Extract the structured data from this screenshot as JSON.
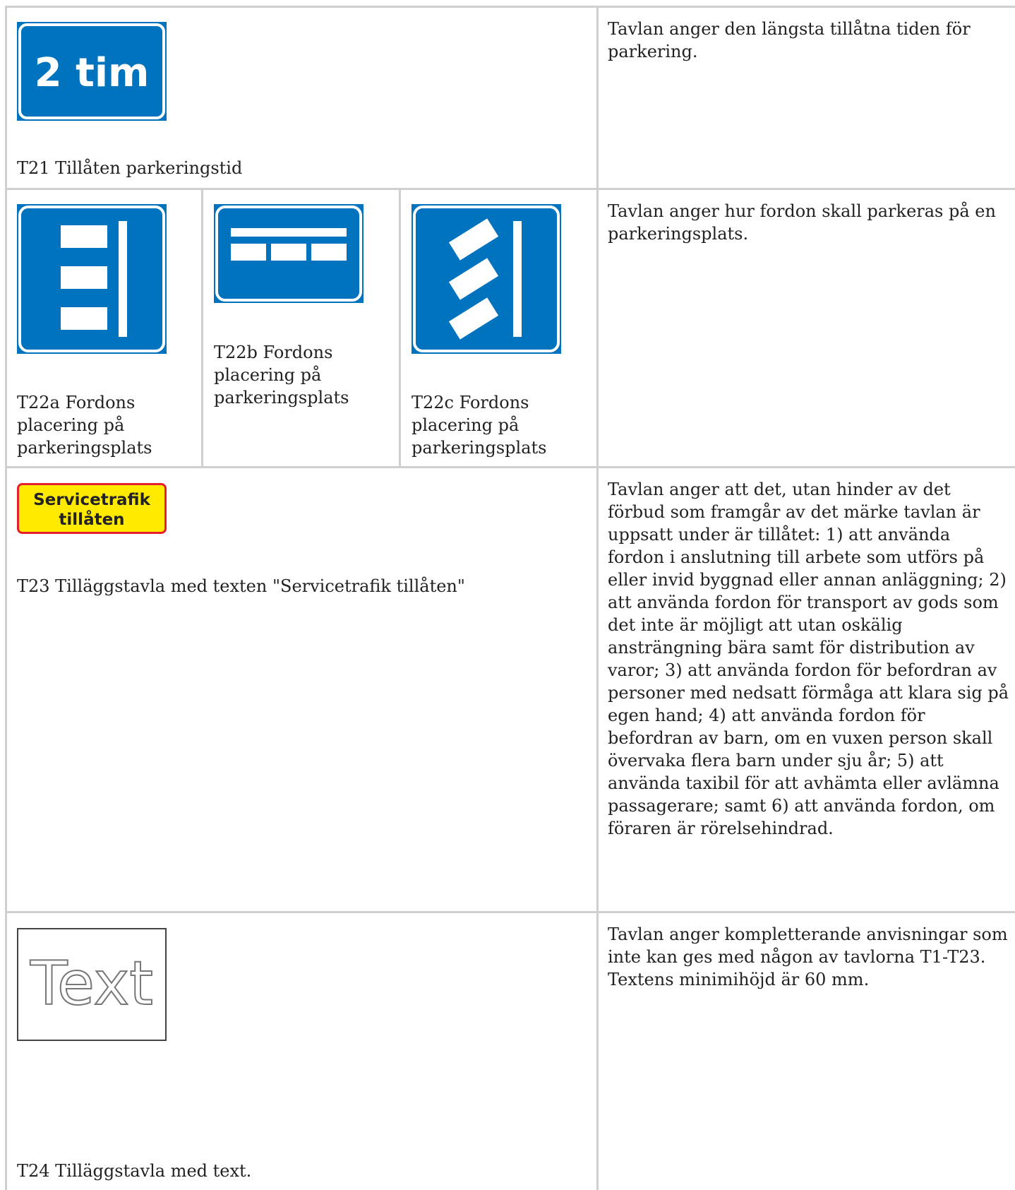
{
  "rows": [
    {
      "signs": [
        {
          "sign_text": "2 tim",
          "caption": "T21 Tillåten parkeringstid"
        }
      ],
      "description": "Tavlan anger den längsta tillåtna tiden för parkering."
    },
    {
      "signs": [
        {
          "caption": "T22a Fordons placering på parkeringsplats"
        },
        {
          "caption": "T22b Fordons placering på parkeringsplats"
        },
        {
          "caption": "T22c Fordons placering på parkeringsplats"
        }
      ],
      "description": "Tavlan anger hur fordon skall parkeras på en parkeringsplats."
    },
    {
      "signs": [
        {
          "sign_text_line1": "Servicetrafik",
          "sign_text_line2": "tillåten",
          "caption": "T23 Tilläggstavla med texten \"Servicetrafik tillåten\""
        }
      ],
      "description": "Tavlan anger att det, utan hinder av det förbud som framgår av det märke tavlan är uppsatt under är tillåtet: 1) att använda fordon i anslutning till arbete som utförs på eller invid byggnad eller annan anläggning; 2) att använda fordon för transport av gods som det inte är möjligt att utan oskälig ansträngning bära samt för distribution av varor; 3) att använda fordon för befordran av personer med nedsatt förmåga att klara sig på egen hand; 4) att använda fordon för befordran av barn, om en vuxen person skall övervaka flera barn under sju år; 5) att använda taxibil för att avhämta eller avlämna passagerare; samt 6) att använda fordon, om föraren är rörelsehindrad."
    },
    {
      "signs": [
        {
          "sign_text": "Text",
          "caption": "T24 Tilläggstavla med text."
        }
      ],
      "description": "Tavlan anger kompletterande anvisningar som inte kan ges med någon av tavlorna T1-T23. Textens minimihöjd är 60 mm."
    }
  ],
  "colors": {
    "sign_blue": "#0073bf",
    "sign_yellow": "#ffea00",
    "sign_red": "#e3202b",
    "border": "#cfcfcf"
  }
}
